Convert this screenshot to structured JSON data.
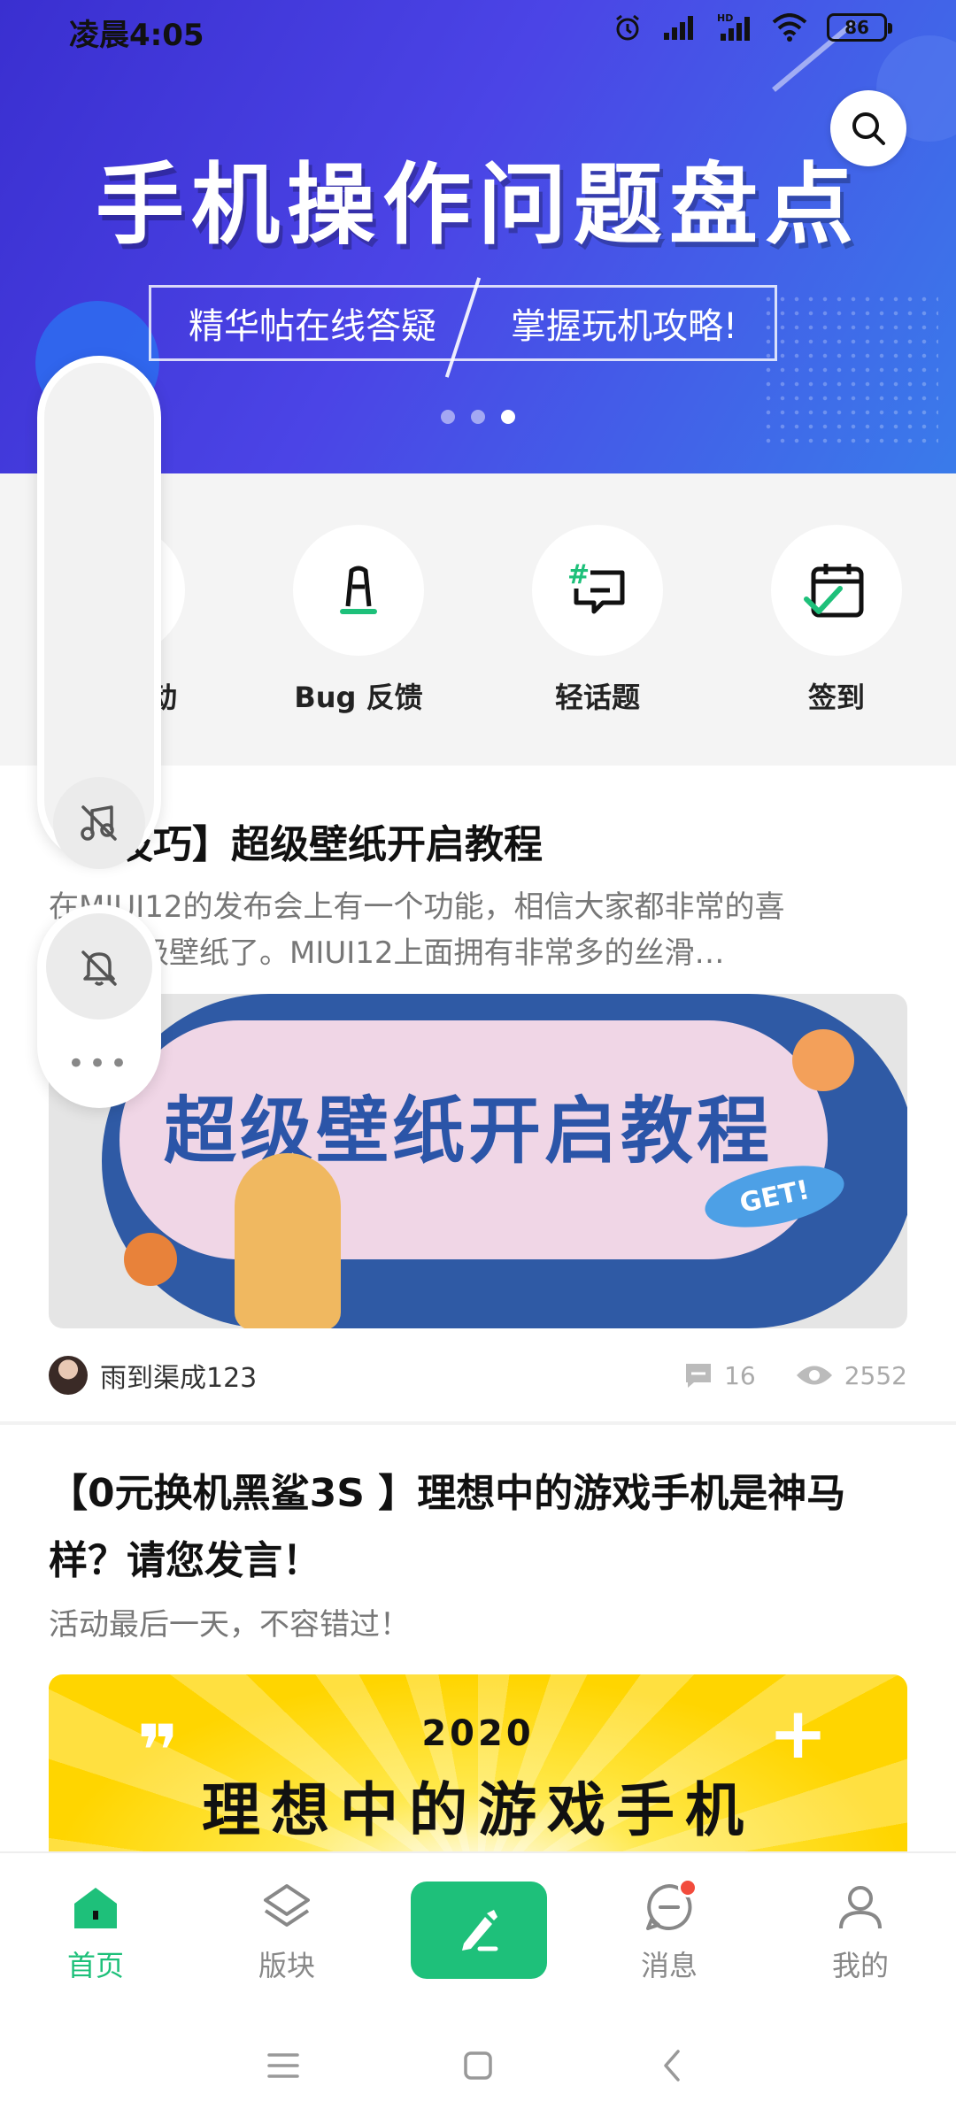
{
  "status_bar": {
    "time": "凌晨4:05",
    "network_label": "HD",
    "battery": "86"
  },
  "banner": {
    "title": "手机操作问题盘点",
    "subtitle_left": "精华帖在线答疑",
    "subtitle_right": "掌握玩机攻略!",
    "pages": 3,
    "active_page": 3
  },
  "quick_entries": [
    {
      "label": "动",
      "icon": "activity-icon"
    },
    {
      "label": "Bug 反馈",
      "icon": "bug-feedback-icon"
    },
    {
      "label": "轻话题",
      "icon": "topic-icon"
    },
    {
      "label": "签到",
      "icon": "check-in-icon"
    }
  ],
  "posts": [
    {
      "title": "机技巧】超级壁纸开启教程",
      "excerpt_line1": "在MIUI12的发布会上有一个功能，相信大家都非常的喜",
      "excerpt_line2": "就是超级壁纸了。MIUI12上面拥有非常多的丝滑…",
      "image_text": "超级壁纸开启教程",
      "image_badge": "GET!",
      "author": "雨到渠成123",
      "comments": "16",
      "views": "2552"
    },
    {
      "title": "【0元换机黑鲨3S 】理想中的游戏手机是神马样？请您发言！",
      "excerpt": "活动最后一天，不容错过！",
      "image_year": "2020",
      "image_text": "理想中的游戏手机"
    }
  ],
  "side_panel": {
    "more_label": "•••"
  },
  "tabbar": {
    "items": [
      {
        "label": "首页",
        "icon": "home-icon",
        "active": true
      },
      {
        "label": "版块",
        "icon": "layers-icon",
        "active": false
      },
      {
        "label": "",
        "icon": "compose-icon",
        "active": false
      },
      {
        "label": "消息",
        "icon": "message-icon",
        "active": false,
        "badge": true
      },
      {
        "label": "我的",
        "icon": "profile-icon",
        "active": false
      }
    ]
  },
  "colors": {
    "accent": "#1ec07a",
    "banner_start": "#3a2fd0",
    "banner_end": "#3a7bea",
    "badge": "#f24b3c"
  }
}
